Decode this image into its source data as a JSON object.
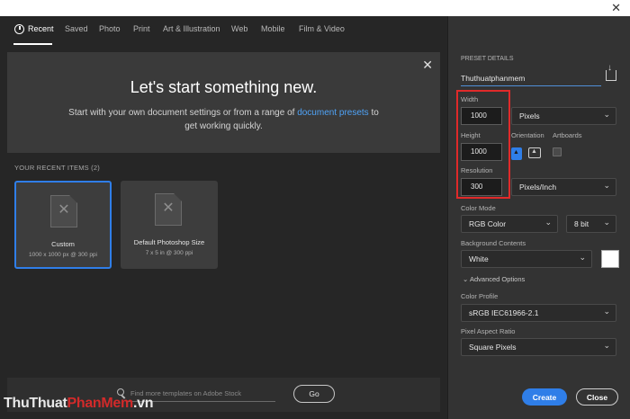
{
  "tabs": [
    {
      "label": "Recent",
      "active": true
    },
    {
      "label": "Saved"
    },
    {
      "label": "Photo"
    },
    {
      "label": "Print"
    },
    {
      "label": "Art & Illustration"
    },
    {
      "label": "Web"
    },
    {
      "label": "Mobile"
    },
    {
      "label": "Film & Video"
    }
  ],
  "hero": {
    "title": "Let's start something new.",
    "subtitle_before": "Start with your own document settings or from a range of",
    "subtitle_link": "document presets",
    "subtitle_after": "to get working quickly."
  },
  "recent": {
    "label": "YOUR RECENT ITEMS",
    "count": "(2)",
    "items": [
      {
        "name": "Custom",
        "info": "1000 x 1000 px @ 300 ppi"
      },
      {
        "name": "Default Photoshop Size",
        "info": "7 x 5 in @ 300 ppi"
      }
    ]
  },
  "search": {
    "placeholder": "Find more templates on Adobe Stock",
    "go_label": "Go"
  },
  "preset": {
    "section_label": "PRESET DETAILS",
    "name": "Thuthuatphanmem",
    "width_label": "Width",
    "width_value": "1000",
    "width_unit": "Pixels",
    "height_label": "Height",
    "height_value": "1000",
    "orientation_label": "Orientation",
    "artboards_label": "Artboards",
    "resolution_label": "Resolution",
    "resolution_value": "300",
    "resolution_unit": "Pixels/Inch",
    "color_mode_label": "Color Mode",
    "color_mode_value": "RGB Color",
    "bit_depth": "8 bit",
    "background_label": "Background Contents",
    "background_value": "White",
    "advanced_label": "Advanced Options",
    "color_profile_label": "Color Profile",
    "color_profile_value": "sRGB IEC61966-2.1",
    "aspect_label": "Pixel Aspect Ratio",
    "aspect_value": "Square Pixels"
  },
  "actions": {
    "create": "Create",
    "close": "Close"
  },
  "watermark": {
    "part1": "ThuThuat",
    "part2": "PhanMem",
    "part3": ".vn"
  },
  "colors": {
    "accent": "#2f7ee8",
    "highlight": "#e02a2a",
    "link": "#4fa3f7"
  }
}
